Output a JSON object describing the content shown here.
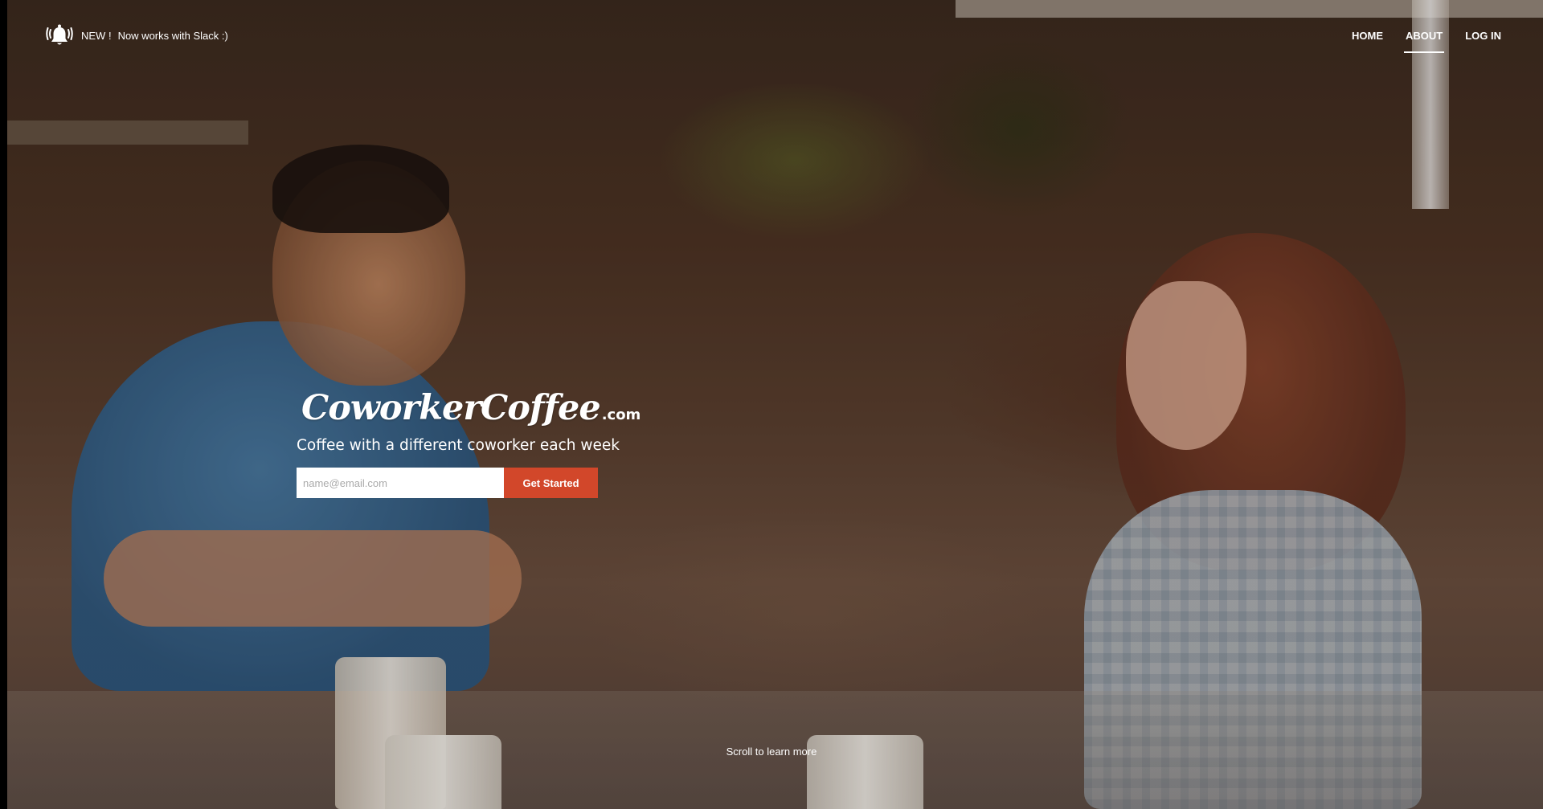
{
  "notice": {
    "icon": "bell-icon",
    "new_label": "NEW !",
    "message": "Now works with Slack :)"
  },
  "nav": {
    "home": "HOME",
    "about": "ABOUT",
    "login": "LOG IN",
    "active": "ABOUT"
  },
  "hero": {
    "logo_icon": "coffee-cup-icon",
    "brand": "CoworkerCoffee",
    "brand_suffix": ".com",
    "tagline": "Coffee with a different coworker each week",
    "email_placeholder": "name@email.com",
    "email_value": "",
    "cta_label": "Get Started"
  },
  "footer": {
    "scroll_hint": "Scroll to learn more"
  },
  "colors": {
    "cta": "#d2472a",
    "text": "#ffffff"
  }
}
